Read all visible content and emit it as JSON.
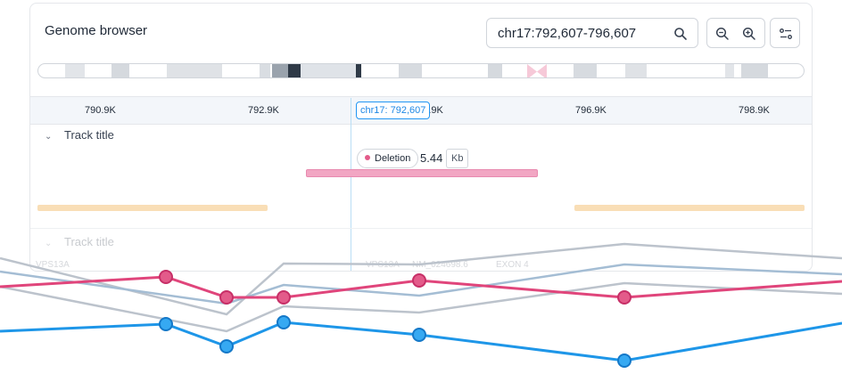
{
  "header": {
    "title": "Genome browser"
  },
  "search": {
    "value": "chr17:792,607-796,607"
  },
  "ruler": {
    "ticks": [
      "790.9K",
      "792.9K",
      "794.9K",
      "796.9K",
      "798.9K"
    ],
    "position_label": "chr17: 792,607"
  },
  "tracks": [
    {
      "title": "Track title",
      "badge_label": "Deletion",
      "size_value": "5.44",
      "size_unit": "Kb"
    },
    {
      "title": "Track title",
      "genes": [
        "VPS13A",
        "VPS13A",
        "NM_024698.6",
        "EXON 4"
      ]
    }
  ],
  "colors": {
    "accent": "#2196f3",
    "deletion": "#f2a6c3",
    "feature": "#f9deb6",
    "series_pink": "#e0457b",
    "series_blue": "#1e96e8",
    "series_gray": "#bcc3cc",
    "series_steel": "#a4bdd4"
  },
  "icons": [
    "search-icon",
    "zoom-out-icon",
    "zoom-in-icon",
    "settings-icon",
    "chevron-down-icon"
  ]
}
